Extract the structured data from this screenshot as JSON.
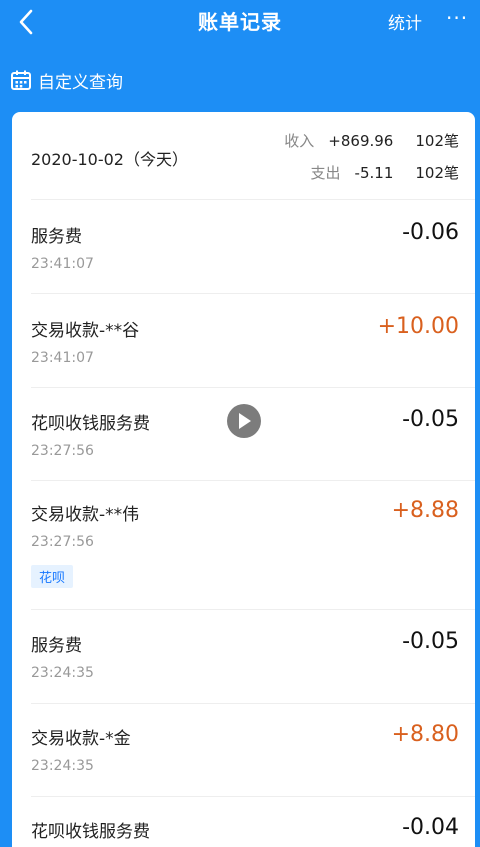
{
  "header": {
    "title": "账单记录",
    "stats_label": "统计",
    "more_label": "···"
  },
  "query": {
    "label": "自定义查询"
  },
  "summary": {
    "date": "2020-10-02（今天）",
    "income_label": "收入",
    "income_amount": "+869.96",
    "income_count": "102笔",
    "expense_label": "支出",
    "expense_amount": "-5.11",
    "expense_count": "102笔"
  },
  "transactions": [
    {
      "name": "服务费",
      "time": "23:41:07",
      "amount": "-0.06"
    },
    {
      "name": "交易收款-**谷",
      "time": "23:41:07",
      "amount": "+10.00"
    },
    {
      "name": "花呗收钱服务费",
      "time": "23:27:56",
      "amount": "-0.05"
    },
    {
      "name": "交易收款-**伟",
      "time": "23:27:56",
      "amount": "+8.88",
      "tag": "花呗"
    },
    {
      "name": "服务费",
      "time": "23:24:35",
      "amount": "-0.05"
    },
    {
      "name": "交易收款-*金",
      "time": "23:24:35",
      "amount": "+8.80"
    },
    {
      "name": "花呗收钱服务费",
      "time": "",
      "amount": "-0.04"
    }
  ],
  "colors": {
    "brand": "#1d8ef5",
    "positive": "#d9601e",
    "tag_text": "#1677ff",
    "tag_bg": "#e6f2ff"
  },
  "icons": {
    "back": "chevron-left-icon",
    "calendar": "calendar-icon",
    "play": "play-icon"
  }
}
